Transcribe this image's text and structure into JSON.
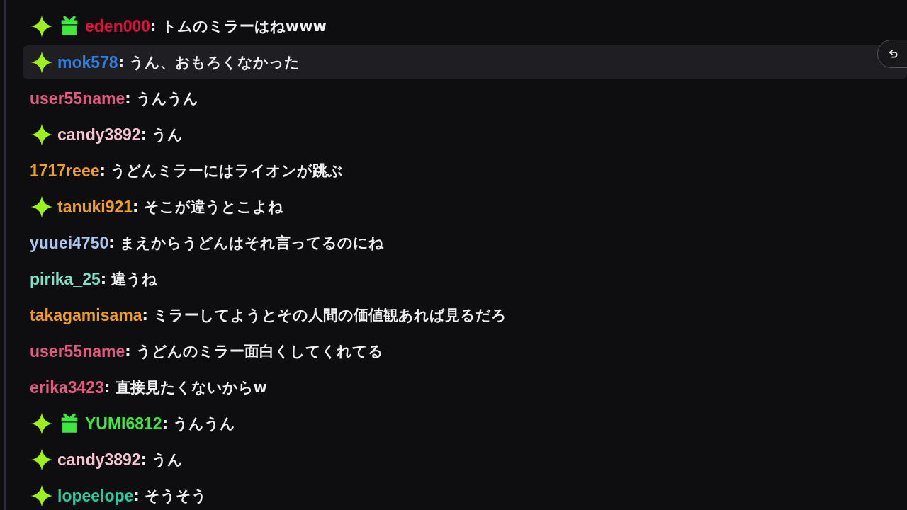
{
  "messages": [
    {
      "badges": [
        {
          "kind": "sparkle"
        },
        {
          "kind": "gift"
        }
      ],
      "user": "eden000",
      "color": "#e0103a",
      "text": ": トムのミラーはねwww",
      "highlighted": false
    },
    {
      "badges": [
        {
          "kind": "sparkle"
        }
      ],
      "user": "mok578",
      "color": "#2f7ee0",
      "text": ": うん、おもろくなかった",
      "highlighted": true
    },
    {
      "user": "user55name",
      "color": "#e35a80",
      "text": ": うんうん",
      "highlighted": false
    },
    {
      "badges": [
        {
          "kind": "sparkle"
        }
      ],
      "user": "candy3892",
      "color": "#f3c6d2",
      "text": ": うん",
      "highlighted": false
    },
    {
      "user": "1717reee",
      "color": "#f0a020",
      "text": ": うどんミラーにはライオンが跳ぶ",
      "highlighted": false
    },
    {
      "badges": [
        {
          "kind": "sparkle"
        }
      ],
      "user": "tanuki921",
      "color": "#f0a020",
      "text": ": そこが違うとこよね",
      "highlighted": false
    },
    {
      "user": "yuuei4750",
      "color": "#a9c6ee",
      "text": ": まえからうどんはそれ言ってるのにね",
      "highlighted": false
    },
    {
      "user": "pirika_25",
      "color": "#7fe0c8",
      "text": ": 違うね",
      "highlighted": false
    },
    {
      "user": "takagamisama",
      "color": "#f0a020",
      "text": ": ミラーしてようとその人間の価値観あれば見るだろ",
      "highlighted": false
    },
    {
      "user": "user55name",
      "color": "#e35a80",
      "text": ": うどんのミラー面白くしてくれてる",
      "highlighted": false
    },
    {
      "user": "erika3423",
      "color": "#e35a80",
      "text": ": 直接見たくないからw",
      "highlighted": false
    },
    {
      "badges": [
        {
          "kind": "sparkle"
        },
        {
          "kind": "gift"
        }
      ],
      "user": "YUMI6812",
      "color": "#3ee83e",
      "text": ": うんうん",
      "highlighted": false
    },
    {
      "badges": [
        {
          "kind": "sparkle"
        }
      ],
      "user": "candy3892",
      "color": "#f3c6d2",
      "text": ": うん",
      "highlighted": false
    },
    {
      "badges": [
        {
          "kind": "sparkle"
        }
      ],
      "user": "lopeelope",
      "color": "#20d0a0",
      "text": ": そうそう",
      "highlighted": false
    }
  ]
}
